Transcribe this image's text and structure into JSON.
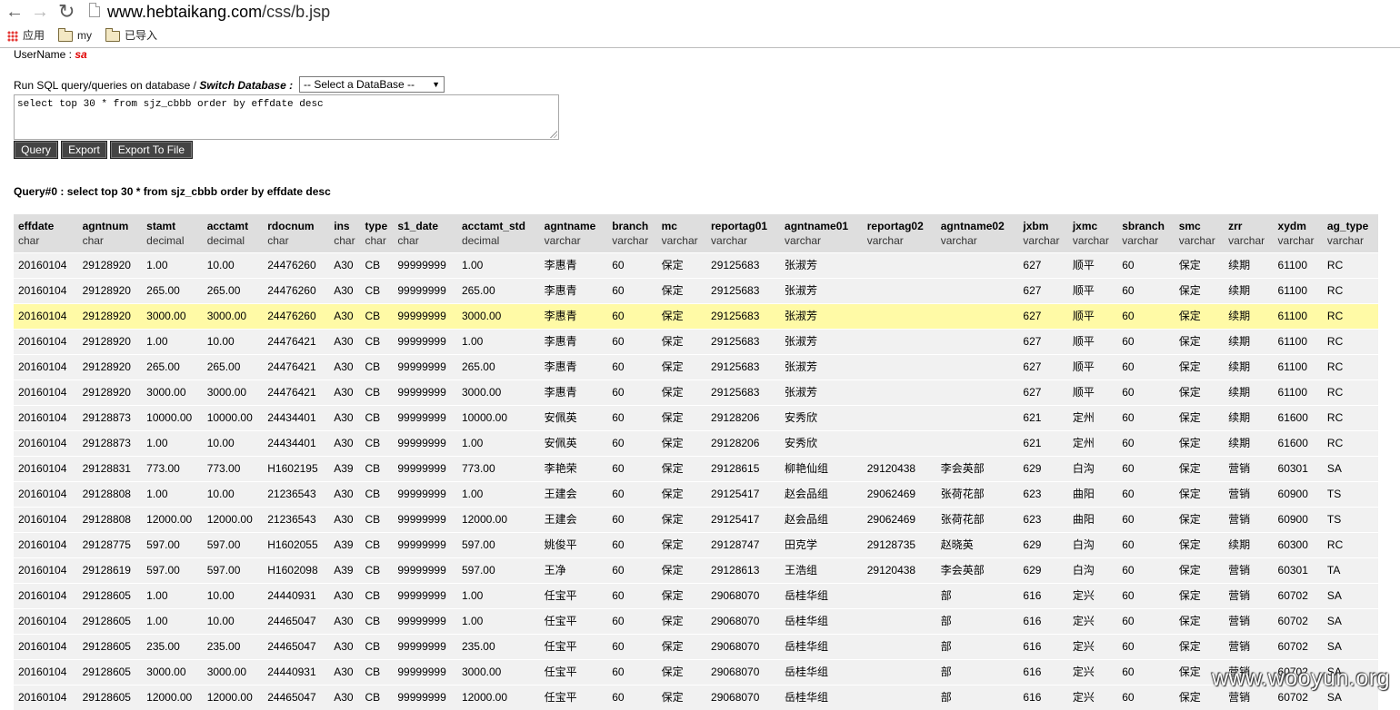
{
  "browser": {
    "url_domain": "www.hebtaikang.com",
    "url_path": "/css/b.jsp",
    "bookmarks": [
      {
        "label": "应用",
        "icon": "apps-grid-icon"
      },
      {
        "label": "my",
        "icon": "folder-icon"
      },
      {
        "label": "已导入",
        "icon": "folder-icon"
      }
    ]
  },
  "page": {
    "username_label": "UserName :",
    "username_value": "sa",
    "run_sql_label": "Run SQL query/queries on database /",
    "switch_db_label": "Switch Database :",
    "db_select_value": "-- Select a DataBase --",
    "sql_text": "select top 30 * from sjz_cbbb order by effdate desc",
    "buttons": {
      "query": "Query",
      "export": "Export",
      "export_file": "Export To File"
    },
    "query_title": "Query#0 : select top 30 * from sjz_cbbb order by effdate desc"
  },
  "table": {
    "columns": [
      {
        "name": "effdate",
        "type": "char"
      },
      {
        "name": "agntnum",
        "type": "char"
      },
      {
        "name": "stamt",
        "type": "decimal"
      },
      {
        "name": "acctamt",
        "type": "decimal"
      },
      {
        "name": "rdocnum",
        "type": "char"
      },
      {
        "name": "ins",
        "type": "char"
      },
      {
        "name": "type",
        "type": "char"
      },
      {
        "name": "s1_date",
        "type": "char"
      },
      {
        "name": "acctamt_std",
        "type": "decimal"
      },
      {
        "name": "agntname",
        "type": "varchar"
      },
      {
        "name": "branch",
        "type": "varchar"
      },
      {
        "name": "mc",
        "type": "varchar"
      },
      {
        "name": "reportag01",
        "type": "varchar"
      },
      {
        "name": "agntname01",
        "type": "varchar"
      },
      {
        "name": "reportag02",
        "type": "varchar"
      },
      {
        "name": "agntname02",
        "type": "varchar"
      },
      {
        "name": "jxbm",
        "type": "varchar"
      },
      {
        "name": "jxmc",
        "type": "varchar"
      },
      {
        "name": "sbranch",
        "type": "varchar"
      },
      {
        "name": "smc",
        "type": "varchar"
      },
      {
        "name": "zrr",
        "type": "varchar"
      },
      {
        "name": "xydm",
        "type": "varchar"
      },
      {
        "name": "ag_type",
        "type": "varchar"
      }
    ],
    "highlighted_row": 2,
    "rows": [
      [
        "20160104",
        "29128920",
        "1.00",
        "10.00",
        "24476260",
        "A30",
        "CB",
        "99999999",
        "1.00",
        "李惠青",
        "60",
        "保定",
        "29125683",
        "张淑芳",
        "",
        "",
        "627",
        "顺平",
        "60",
        "保定",
        "续期",
        "61100",
        "RC"
      ],
      [
        "20160104",
        "29128920",
        "265.00",
        "265.00",
        "24476260",
        "A30",
        "CB",
        "99999999",
        "265.00",
        "李惠青",
        "60",
        "保定",
        "29125683",
        "张淑芳",
        "",
        "",
        "627",
        "顺平",
        "60",
        "保定",
        "续期",
        "61100",
        "RC"
      ],
      [
        "20160104",
        "29128920",
        "3000.00",
        "3000.00",
        "24476260",
        "A30",
        "CB",
        "99999999",
        "3000.00",
        "李惠青",
        "60",
        "保定",
        "29125683",
        "张淑芳",
        "",
        "",
        "627",
        "顺平",
        "60",
        "保定",
        "续期",
        "61100",
        "RC"
      ],
      [
        "20160104",
        "29128920",
        "1.00",
        "10.00",
        "24476421",
        "A30",
        "CB",
        "99999999",
        "1.00",
        "李惠青",
        "60",
        "保定",
        "29125683",
        "张淑芳",
        "",
        "",
        "627",
        "顺平",
        "60",
        "保定",
        "续期",
        "61100",
        "RC"
      ],
      [
        "20160104",
        "29128920",
        "265.00",
        "265.00",
        "24476421",
        "A30",
        "CB",
        "99999999",
        "265.00",
        "李惠青",
        "60",
        "保定",
        "29125683",
        "张淑芳",
        "",
        "",
        "627",
        "顺平",
        "60",
        "保定",
        "续期",
        "61100",
        "RC"
      ],
      [
        "20160104",
        "29128920",
        "3000.00",
        "3000.00",
        "24476421",
        "A30",
        "CB",
        "99999999",
        "3000.00",
        "李惠青",
        "60",
        "保定",
        "29125683",
        "张淑芳",
        "",
        "",
        "627",
        "顺平",
        "60",
        "保定",
        "续期",
        "61100",
        "RC"
      ],
      [
        "20160104",
        "29128873",
        "10000.00",
        "10000.00",
        "24434401",
        "A30",
        "CB",
        "99999999",
        "10000.00",
        "安佩英",
        "60",
        "保定",
        "29128206",
        "安秀欣",
        "",
        "",
        "621",
        "定州",
        "60",
        "保定",
        "续期",
        "61600",
        "RC"
      ],
      [
        "20160104",
        "29128873",
        "1.00",
        "10.00",
        "24434401",
        "A30",
        "CB",
        "99999999",
        "1.00",
        "安佩英",
        "60",
        "保定",
        "29128206",
        "安秀欣",
        "",
        "",
        "621",
        "定州",
        "60",
        "保定",
        "续期",
        "61600",
        "RC"
      ],
      [
        "20160104",
        "29128831",
        "773.00",
        "773.00",
        "H1602195",
        "A39",
        "CB",
        "99999999",
        "773.00",
        "李艳荣",
        "60",
        "保定",
        "29128615",
        "柳艳仙组",
        "29120438",
        "李会英部",
        "629",
        "白沟",
        "60",
        "保定",
        "营销",
        "60301",
        "SA"
      ],
      [
        "20160104",
        "29128808",
        "1.00",
        "10.00",
        "21236543",
        "A30",
        "CB",
        "99999999",
        "1.00",
        "王建会",
        "60",
        "保定",
        "29125417",
        "赵会品组",
        "29062469",
        "张荷花部",
        "623",
        "曲阳",
        "60",
        "保定",
        "营销",
        "60900",
        "TS"
      ],
      [
        "20160104",
        "29128808",
        "12000.00",
        "12000.00",
        "21236543",
        "A30",
        "CB",
        "99999999",
        "12000.00",
        "王建会",
        "60",
        "保定",
        "29125417",
        "赵会品组",
        "29062469",
        "张荷花部",
        "623",
        "曲阳",
        "60",
        "保定",
        "营销",
        "60900",
        "TS"
      ],
      [
        "20160104",
        "29128775",
        "597.00",
        "597.00",
        "H1602055",
        "A39",
        "CB",
        "99999999",
        "597.00",
        "姚俊平",
        "60",
        "保定",
        "29128747",
        "田克学",
        "29128735",
        "赵晓英",
        "629",
        "白沟",
        "60",
        "保定",
        "续期",
        "60300",
        "RC"
      ],
      [
        "20160104",
        "29128619",
        "597.00",
        "597.00",
        "H1602098",
        "A39",
        "CB",
        "99999999",
        "597.00",
        "王净",
        "60",
        "保定",
        "29128613",
        "王浩组",
        "29120438",
        "李会英部",
        "629",
        "白沟",
        "60",
        "保定",
        "营销",
        "60301",
        "TA"
      ],
      [
        "20160104",
        "29128605",
        "1.00",
        "10.00",
        "24440931",
        "A30",
        "CB",
        "99999999",
        "1.00",
        "任宝平",
        "60",
        "保定",
        "29068070",
        "岳桂华组",
        "",
        "部",
        "616",
        "定兴",
        "60",
        "保定",
        "营销",
        "60702",
        "SA"
      ],
      [
        "20160104",
        "29128605",
        "1.00",
        "10.00",
        "24465047",
        "A30",
        "CB",
        "99999999",
        "1.00",
        "任宝平",
        "60",
        "保定",
        "29068070",
        "岳桂华组",
        "",
        "部",
        "616",
        "定兴",
        "60",
        "保定",
        "营销",
        "60702",
        "SA"
      ],
      [
        "20160104",
        "29128605",
        "235.00",
        "235.00",
        "24465047",
        "A30",
        "CB",
        "99999999",
        "235.00",
        "任宝平",
        "60",
        "保定",
        "29068070",
        "岳桂华组",
        "",
        "部",
        "616",
        "定兴",
        "60",
        "保定",
        "营销",
        "60702",
        "SA"
      ],
      [
        "20160104",
        "29128605",
        "3000.00",
        "3000.00",
        "24440931",
        "A30",
        "CB",
        "99999999",
        "3000.00",
        "任宝平",
        "60",
        "保定",
        "29068070",
        "岳桂华组",
        "",
        "部",
        "616",
        "定兴",
        "60",
        "保定",
        "营销",
        "60702",
        "SA"
      ],
      [
        "20160104",
        "29128605",
        "12000.00",
        "12000.00",
        "24465047",
        "A30",
        "CB",
        "99999999",
        "12000.00",
        "任宝平",
        "60",
        "保定",
        "29068070",
        "岳桂华组",
        "",
        "部",
        "616",
        "定兴",
        "60",
        "保定",
        "营销",
        "60702",
        "SA"
      ]
    ]
  },
  "watermark": "www.wooyun.org"
}
